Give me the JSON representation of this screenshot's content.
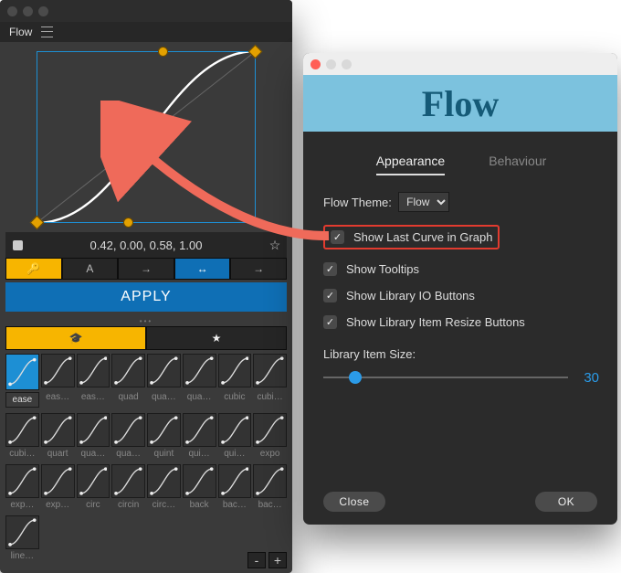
{
  "main": {
    "title": "Flow",
    "bezier_values": "0.42, 0.00, 0.58, 1.00",
    "mode_labels": {
      "key": "",
      "text": "A",
      "arrow_a": "→",
      "arrow_b": "↔",
      "arrow_c": "→"
    },
    "apply_label": "APPLY",
    "library_rows": [
      [
        "ease",
        "eas…",
        "eas…",
        "quad",
        "qua…",
        "qua…",
        "cubic",
        "cubi…"
      ],
      [
        "cubi…",
        "quart",
        "qua…",
        "qua…",
        "quint",
        "qui…",
        "qui…",
        "expo"
      ],
      [
        "exp…",
        "exp…",
        "circ",
        "circin",
        "circ…",
        "back",
        "bac…",
        "bac…"
      ],
      [
        "line…",
        "",
        "",
        "",
        "",
        "",
        "",
        ""
      ]
    ],
    "library_selected": 0,
    "footer": {
      "minus": "-",
      "plus": "+"
    }
  },
  "dialog": {
    "logo_text": "Flow",
    "tabs": {
      "appearance": "Appearance",
      "behaviour": "Behaviour"
    },
    "theme_label": "Flow Theme:",
    "theme_value": "Flow",
    "checks": {
      "last_curve": "Show Last Curve in Graph",
      "tooltips": "Show Tooltips",
      "io_buttons": "Show Library IO Buttons",
      "resize_buttons": "Show Library Item Resize Buttons"
    },
    "slider_label": "Library Item Size:",
    "slider_value": "30",
    "close": "Close",
    "ok": "OK"
  },
  "chart_data": {
    "type": "line",
    "title": "Bezier easing curve editor",
    "xrange": [
      0,
      1
    ],
    "yrange": [
      0,
      1
    ],
    "control_points": [
      [
        0,
        0
      ],
      [
        0.42,
        0.0
      ],
      [
        0.58,
        1.0
      ],
      [
        1,
        1
      ]
    ],
    "bezier": "cubic-bezier(0.42, 0.00, 0.58, 1.00)",
    "last_curve": "linear"
  }
}
